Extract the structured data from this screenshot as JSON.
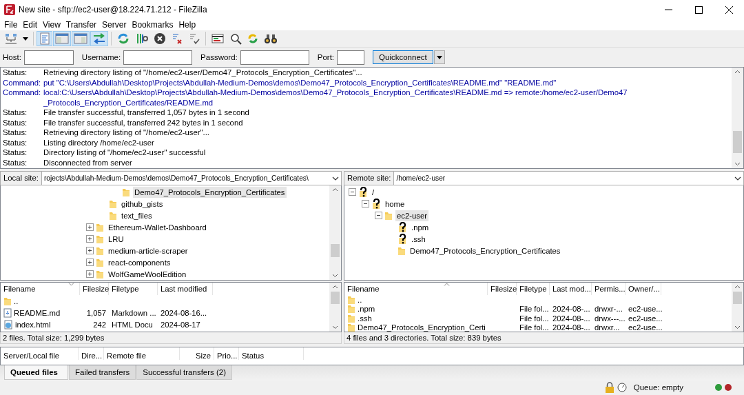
{
  "window": {
    "title": "New site - sftp://ec2-user@18.224.71.212 - FileZilla"
  },
  "menu": [
    "File",
    "Edit",
    "View",
    "Transfer",
    "Server",
    "Bookmarks",
    "Help"
  ],
  "toolbar": [
    {
      "kind": "site-manager",
      "pressed": false
    },
    {
      "kind": "dropdown",
      "pressed": false
    },
    {
      "kind": "message-log",
      "pressed": true
    },
    {
      "kind": "local-tree",
      "pressed": true
    },
    {
      "kind": "remote-tree",
      "pressed": true
    },
    {
      "kind": "transfer-queue",
      "pressed": true
    },
    {
      "kind": "refresh",
      "pressed": false
    },
    {
      "kind": "process-queue",
      "pressed": false
    },
    {
      "kind": "cancel",
      "pressed": false
    },
    {
      "kind": "disconnect",
      "pressed": false
    },
    {
      "kind": "reconnect",
      "pressed": false
    },
    {
      "kind": "compare",
      "pressed": false
    },
    {
      "kind": "search",
      "pressed": false
    },
    {
      "kind": "sync",
      "pressed": false
    },
    {
      "kind": "find",
      "pressed": false
    }
  ],
  "quickconnect": {
    "fields": [
      {
        "label": "Host:"
      },
      {
        "label": "Username:"
      },
      {
        "label": "Password:"
      },
      {
        "label": "Port:"
      }
    ],
    "button": "Quickconnect"
  },
  "message_log": [
    {
      "kind": "status",
      "label": "Status:",
      "lines": [
        "Retrieving directory listing of \"/home/ec2-user/Demo47_Protocols_Encryption_Certificates\"..."
      ]
    },
    {
      "kind": "command",
      "label": "Command:",
      "lines": [
        "put \"C:\\Users\\Abdullah\\Desktop\\Projects\\Abdullah-Medium-Demos\\demos\\Demo47_Protocols_Encryption_Certificates\\README.md\" \"README.md\""
      ]
    },
    {
      "kind": "command",
      "label": "Command:",
      "lines": [
        "local:C:\\Users\\Abdullah\\Desktop\\Projects\\Abdullah-Medium-Demos\\demos\\Demo47_Protocols_Encryption_Certificates\\README.md => remote:/home/ec2-user/Demo47",
        "_Protocols_Encryption_Certificates/README.md"
      ]
    },
    {
      "kind": "status",
      "label": "Status:",
      "lines": [
        "File transfer successful, transferred 1,057 bytes in 1 second"
      ]
    },
    {
      "kind": "status",
      "label": "Status:",
      "lines": [
        "File transfer successful, transferred 242 bytes in 1 second"
      ]
    },
    {
      "kind": "status",
      "label": "Status:",
      "lines": [
        "Retrieving directory listing of \"/home/ec2-user\"..."
      ]
    },
    {
      "kind": "status",
      "label": "Status:",
      "lines": [
        "Listing directory /home/ec2-user"
      ]
    },
    {
      "kind": "status",
      "label": "Status:",
      "lines": [
        "Directory listing of \"/home/ec2-user\" successful"
      ]
    },
    {
      "kind": "status",
      "label": "Status:",
      "lines": [
        "Disconnected from server"
      ]
    }
  ],
  "local": {
    "site_label": "Local site:",
    "path": "rojects\\Abdullah-Medium-Demos\\demos\\Demo47_Protocols_Encryption_Certificates\\",
    "tree": [
      {
        "children": [
          {
            "children": [
              {
                "label": "Demo47_Protocols_Encryption_Certificates",
                "kind": "folder",
                "selected": true
              }
            ]
          },
          {
            "label": "github_gists",
            "kind": "folder",
            "selected": false
          },
          {
            "label": "text_files",
            "kind": "folder",
            "selected": false
          }
        ]
      },
      {
        "label": "Ethereum-Wallet-Dashboard",
        "kind": "folder",
        "selected": false,
        "expanded": false
      },
      {
        "label": "LRU",
        "kind": "folder",
        "selected": false,
        "expanded": false
      },
      {
        "label": "medium-article-scraper",
        "kind": "folder",
        "selected": false,
        "expanded": false
      },
      {
        "label": "react-components",
        "kind": "folder",
        "selected": false,
        "expanded": false
      },
      {
        "label": "WolfGameWoolEdition",
        "kind": "folder",
        "selected": false,
        "expanded": false
      }
    ],
    "columns": [
      {
        "label": "Filename",
        "sort_descending": true
      },
      {
        "label": "Filesize"
      },
      {
        "label": "Filetype"
      },
      {
        "label": "Last modified"
      }
    ],
    "rows": [
      {
        "kind": "folder",
        "cells": [
          ".."
        ]
      },
      {
        "kind": "markdown",
        "cells": [
          "README.md",
          "1,057",
          "Markdown ...",
          "2024-08-16..."
        ]
      },
      {
        "kind": "html",
        "cells": [
          "index.html",
          "242",
          "HTML Docu",
          "2024-08-17"
        ]
      }
    ],
    "summary": "2 files. Total size: 1,299 bytes"
  },
  "remote": {
    "site_label": "Remote site:",
    "path": "/home/ec2-user",
    "tree": [
      {
        "label": "/",
        "kind": "unknown",
        "selected": false,
        "expanded": true,
        "children": [
          {
            "label": "home",
            "kind": "unknown",
            "selected": false,
            "expanded": true,
            "children": [
              {
                "label": "ec2-user",
                "kind": "folder",
                "selected": true,
                "expanded": true,
                "children": [
                  {
                    "label": ".npm",
                    "kind": "unknown",
                    "selected": false
                  },
                  {
                    "label": ".ssh",
                    "kind": "unknown",
                    "selected": false
                  },
                  {
                    "label": "Demo47_Protocols_Encryption_Certificates",
                    "kind": "folder",
                    "selected": false
                  }
                ]
              }
            ]
          }
        ]
      }
    ],
    "columns": [
      {
        "label": "Filename",
        "sort_descending": false
      },
      {
        "label": "Filesize"
      },
      {
        "label": "Filetype"
      },
      {
        "label": "Last mod..."
      },
      {
        "label": "Permis..."
      },
      {
        "label": "Owner/..."
      }
    ],
    "rows": [
      {
        "kind": "folder",
        "cells": [
          ".."
        ]
      },
      {
        "kind": "folder",
        "cells": [
          ".npm",
          "",
          "File fol...",
          "2024-08-...",
          "drwxr-...",
          "ec2-use..."
        ]
      },
      {
        "kind": "folder",
        "cells": [
          ".ssh",
          "",
          "File fol...",
          "2024-08-...",
          "drwx---...",
          "ec2-use..."
        ]
      },
      {
        "kind": "folder",
        "cells": [
          "Demo47_Protocols_Encryption_Certi",
          "",
          "File fol...",
          "2024-08-...",
          "drwxr...",
          "ec2-use..."
        ]
      }
    ],
    "summary": "4 files and 3 directories. Total size: 839 bytes"
  },
  "queue": {
    "columns": [
      "Server/Local file",
      "Dire...",
      "Remote file",
      "Size",
      "Prio...",
      "Status"
    ]
  },
  "queue_tabs": [
    {
      "label": "Queued files",
      "selected": true
    },
    {
      "label": "Failed transfers",
      "selected": false
    },
    {
      "label": "Successful transfers (2)",
      "selected": false
    }
  ],
  "status_bar": {
    "queue": "Queue: empty",
    "lights": [
      {
        "color": "#2e9b3c"
      },
      {
        "color": "#b3262a"
      }
    ]
  }
}
